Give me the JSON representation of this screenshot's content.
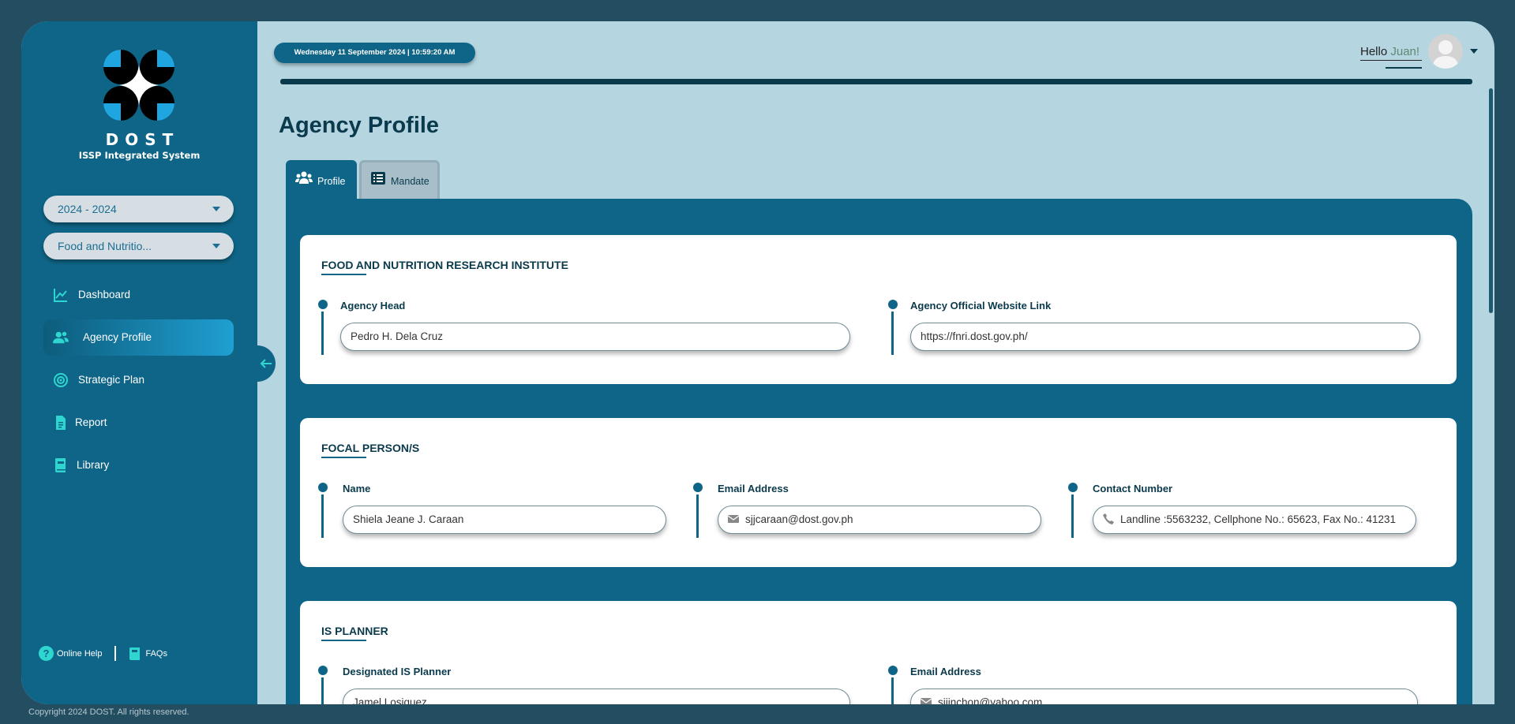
{
  "sidebar": {
    "brand": "DOST",
    "subtitle": "ISSP Integrated System",
    "year_select": "2024 - 2024",
    "agency_select": "Food and Nutritio...",
    "nav": [
      {
        "label": "Dashboard",
        "icon": "chart-line-icon"
      },
      {
        "label": "Agency Profile",
        "icon": "users-icon",
        "active": true
      },
      {
        "label": "Strategic Plan",
        "icon": "target-icon"
      },
      {
        "label": "Report",
        "icon": "document-icon"
      },
      {
        "label": "Library",
        "icon": "book-icon"
      }
    ],
    "online_help": "Online Help",
    "faqs": "FAQs"
  },
  "header": {
    "datetime": "Wednesday 11 September 2024 | 10:59:20 AM",
    "greeting": "Hello ",
    "username": "Juan!"
  },
  "page": {
    "title": "Agency Profile",
    "tabs": [
      {
        "label": "Profile",
        "icon": "users-icon",
        "active": true
      },
      {
        "label": "Mandate",
        "icon": "list-icon"
      }
    ]
  },
  "agency_card": {
    "title": "FOOD AND NUTRITION RESEARCH INSTITUTE",
    "head_label": "Agency Head",
    "head_value": "Pedro H. Dela Cruz",
    "website_label": "Agency Official Website Link",
    "website_value": "https://fnri.dost.gov.ph/"
  },
  "focal_card": {
    "title": "FOCAL PERSON/S",
    "name_label": "Name",
    "name_value": "Shiela Jeane J. Caraan",
    "email_label": "Email Address",
    "email_value": "sjjcaraan@dost.gov.ph",
    "contact_label": "Contact Number",
    "contact_value": "Landline :5563232, Cellphone No.: 65623, Fax No.: 41231"
  },
  "planner_card": {
    "title": "IS PLANNER",
    "planner_label": "Designated IS Planner",
    "planner_value": "Jamel Losiquez",
    "email_label": "Email Address",
    "email_value": "sjjinchon@yahoo.com"
  },
  "footer": "Copyright 2024 DOST. All rights reserved.",
  "colors": {
    "primary": "#0e6587",
    "background": "#b5d5e0",
    "accent": "#2fd6cf",
    "dark": "#0a3a4c"
  }
}
